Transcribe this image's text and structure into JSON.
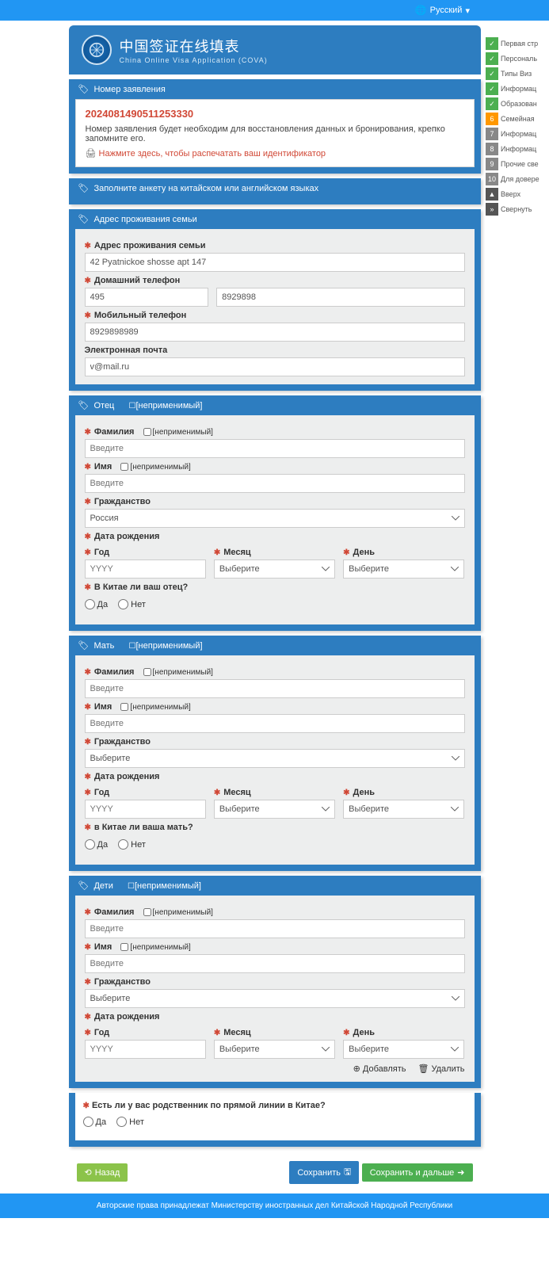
{
  "lang_selector": "Русский",
  "header": {
    "title_cn": "中国签证在线填表",
    "title_en": "China Online Visa Application (COVA)"
  },
  "app_number_panel": {
    "head": "Номер заявления",
    "number": "2024081490511253330",
    "note": "Номер заявления будет необходим для восстановления данных и бронирования, крепко запомните его.",
    "print": "Нажмите здесь, чтобы распечатать ваш идентификатор"
  },
  "lang_note": {
    "head": "Заполните анкету на китайском или английском языках"
  },
  "address_panel": {
    "head": "Адрес проживания семьи",
    "labels": {
      "address": "Адрес проживания семьи",
      "home_phone": "Домашний телефон",
      "mobile": "Мобильный телефон",
      "email": "Электронная почта"
    },
    "values": {
      "address": "42 Pyatnickoe shosse apt 147",
      "phone_code": "495",
      "phone_num": "8929898",
      "mobile": "8929898989",
      "email": "v@mail.ru"
    }
  },
  "na_text": "[неприменимый]",
  "father": {
    "head": "Отец",
    "labels": {
      "surname": "Фамилия",
      "name": "Имя",
      "citizenship": "Гражданство",
      "dob": "Дата рождения",
      "year": "Год",
      "month": "Месяц",
      "day": "День",
      "in_china": "В Китае ли ваш отец?"
    },
    "placeholders": {
      "text": "Введите",
      "year": "YYYY",
      "select": "Выберите"
    },
    "values": {
      "citizenship": "Россия"
    }
  },
  "mother": {
    "head": "Мать",
    "labels": {
      "surname": "Фамилия",
      "name": "Имя",
      "citizenship": "Гражданство",
      "dob": "Дата рождения",
      "year": "Год",
      "month": "Месяц",
      "day": "День",
      "in_china": "в Китае ли ваша мать?"
    },
    "placeholders": {
      "text": "Введите",
      "year": "YYYY",
      "select": "Выберите"
    }
  },
  "children": {
    "head": "Дети",
    "labels": {
      "surname": "Фамилия",
      "name": "Имя",
      "citizenship": "Гражданство",
      "dob": "Дата рождения",
      "year": "Год",
      "month": "Месяц",
      "day": "День"
    },
    "placeholders": {
      "text": "Введите",
      "year": "YYYY",
      "select": "Выберите"
    },
    "actions": {
      "add": "Добавлять",
      "delete": "Удалить"
    }
  },
  "relative_q": "Есть ли у вас родственник по прямой линии в Китае?",
  "radio": {
    "yes": "Да",
    "no": "Нет"
  },
  "buttons": {
    "back": "Назад",
    "save": "Сохранить",
    "next": "Сохранить и дальше"
  },
  "footer": "Авторские права принадлежат Министерству иностранных дел Китайской Народной Республики",
  "side_nav": [
    {
      "badge": "✓",
      "cls": "sb-green",
      "label": "Первая стр"
    },
    {
      "badge": "✓",
      "cls": "sb-green",
      "label": "Персональ"
    },
    {
      "badge": "✓",
      "cls": "sb-green",
      "label": "Типы Виз"
    },
    {
      "badge": "✓",
      "cls": "sb-green",
      "label": "Информац"
    },
    {
      "badge": "✓",
      "cls": "sb-green",
      "label": "Образован"
    },
    {
      "badge": "6",
      "cls": "sb-orange",
      "label": "Семейная"
    },
    {
      "badge": "7",
      "cls": "sb-gray",
      "label": "Информац"
    },
    {
      "badge": "8",
      "cls": "sb-gray",
      "label": "Информац"
    },
    {
      "badge": "9",
      "cls": "sb-gray",
      "label": "Прочие све"
    },
    {
      "badge": "10",
      "cls": "sb-gray",
      "label": "Для довере"
    },
    {
      "badge": "▲",
      "cls": "sb-dark",
      "label": "Вверх"
    },
    {
      "badge": "»",
      "cls": "sb-dark",
      "label": "Свернуть"
    }
  ]
}
